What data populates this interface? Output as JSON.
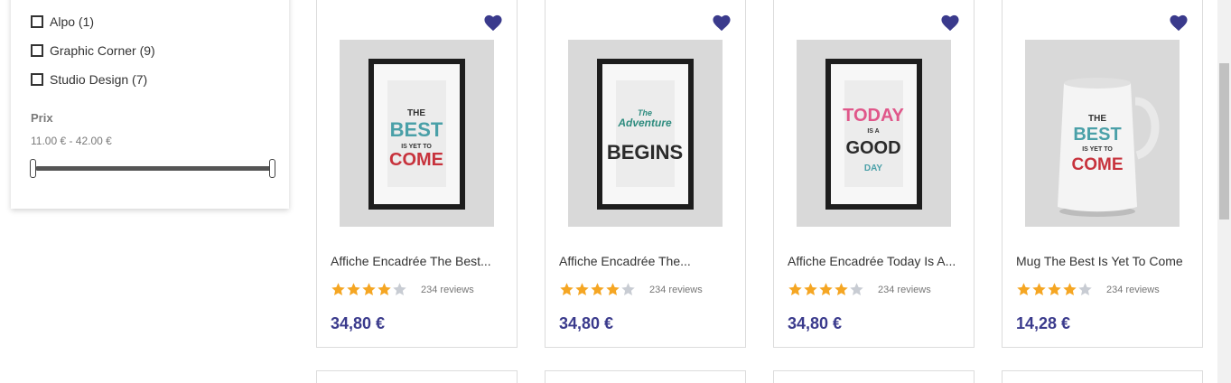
{
  "filters": {
    "brands": [
      {
        "label": "Alpo (1)"
      },
      {
        "label": "Graphic Corner (9)"
      },
      {
        "label": "Studio Design (7)"
      }
    ],
    "price": {
      "title": "Prix",
      "range": "11.00 € - 42.00 €"
    }
  },
  "products": [
    {
      "name": "Affiche Encadrée The Best...",
      "reviews": "234 reviews",
      "price": "34,80 €",
      "rating": 4,
      "image": "frame-best-yet-to-come",
      "poster": {
        "l1": "THE",
        "l2": "BEST",
        "l3": "IS YET TO",
        "l4": "COME"
      }
    },
    {
      "name": "Affiche Encadrée The...",
      "reviews": "234 reviews",
      "price": "34,80 €",
      "rating": 4,
      "image": "frame-adventure-begins",
      "poster": {
        "l1": "The",
        "l2": "Adventure",
        "l3": "BEGINS",
        "l4": ""
      }
    },
    {
      "name": "Affiche Encadrée Today Is A...",
      "reviews": "234 reviews",
      "price": "34,80 €",
      "rating": 4,
      "image": "frame-today-good-day",
      "poster": {
        "l1": "TODAY",
        "l2": "IS A",
        "l3": "GOOD",
        "l4": "DAY"
      }
    },
    {
      "name": "Mug The Best Is Yet To Come",
      "reviews": "234 reviews",
      "price": "14,28 €",
      "rating": 4,
      "image": "mug-best-yet-to-come",
      "poster": {
        "l1": "THE",
        "l2": "BEST",
        "l3": "IS YET TO",
        "l4": "COME"
      }
    }
  ],
  "colors": {
    "price": "#3a3a8c",
    "heart": "#3a3a8c",
    "star_filled": "#f5a623",
    "star_empty": "#c8ccd3"
  },
  "icons": {
    "favorite": "heart-icon",
    "star": "star-icon"
  }
}
